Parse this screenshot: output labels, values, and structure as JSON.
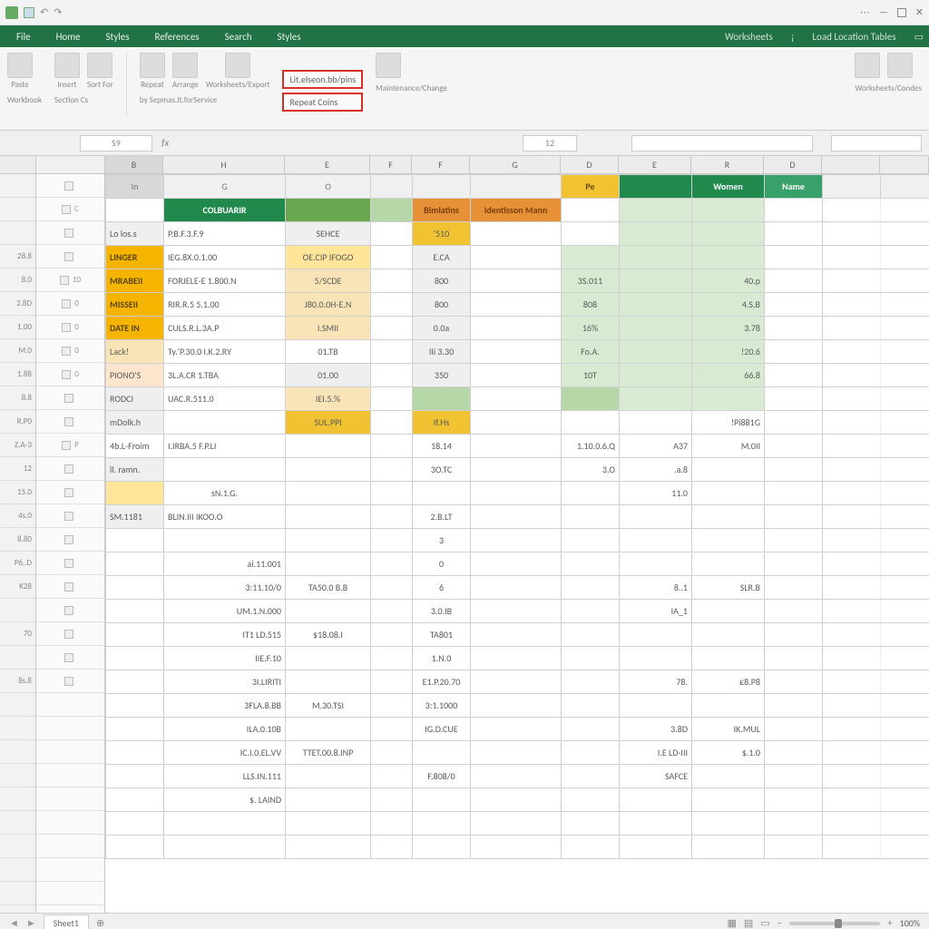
{
  "titlebar": {
    "qat_save": "",
    "account": "",
    "minimize": "—"
  },
  "tabs": {
    "file": "File",
    "home": "Home",
    "insert": "Styles",
    "pagelayout": "References",
    "formulas": "Search",
    "data": "Styles",
    "review": "Worksheets",
    "view": "Load Location Tables",
    "help": ""
  },
  "ribbon": {
    "btn1": "Paste",
    "btn1b": "",
    "grp1_cap": "Workbook",
    "btn2": "Insert",
    "btn3": "Sort For",
    "btn4": "Repeat",
    "btn4_cap": "Section Cs",
    "btn5": "Arrange",
    "btn5_cap": "by Sepmas.It.forService",
    "btn6": "Worksheets/Export",
    "boxed_top": "Lit.elseon.bb/pins",
    "boxed_bottom": "Repeat Coins",
    "btn7": "Maintenance/Change",
    "btn8_cap": "Worksheets/Condes"
  },
  "fx": {
    "name": "S9",
    "font_size": "12"
  },
  "col_top": {
    "B": "B",
    "C": "H",
    "D": "E",
    "E": "F",
    "F": "F",
    "G": "G",
    "H": "D",
    "I": "E",
    "J": "R",
    "K": "D"
  },
  "subhdr": {
    "B": "In",
    "C": "G",
    "D": "O",
    "H": "Pe",
    "J": "Women",
    "K": "Name"
  },
  "left_labels": [
    "",
    "",
    "",
    "28.8",
    "8.0",
    "2.8D",
    "1.00",
    "M.0",
    "1.88",
    "8.8",
    "R.P0",
    "Z.A-3",
    "12",
    "15.0",
    "4s.0",
    "8.80",
    "P6..D",
    "K28",
    "",
    "70",
    "",
    "8s.8",
    ""
  ],
  "mid_labels": [
    "",
    "C",
    "",
    "",
    "10",
    "0",
    "0",
    "0",
    "0",
    "",
    "",
    "P",
    "",
    "",
    "",
    "",
    "",
    "",
    "",
    "",
    "",
    ""
  ],
  "rows": [
    {
      "b": "",
      "b_cls": "",
      "c": "COLBUARIR",
      "c_cls": "hdr-green-dark",
      "d": "",
      "d_cls": "cell-grn-bar",
      "e": "",
      "e_cls": "cell-green-md",
      "f": "Bimlatins",
      "f_cls": "hdr-orange",
      "g": "Identisson Mann",
      "g_cls": "hdr-orange",
      "h": "",
      "i": "",
      "i_cls": "cell-green-lt",
      "j": "",
      "j_cls": "cell-green-lt",
      "k": ""
    },
    {
      "b": "Lo los.s",
      "b_cls": "lab cell-gray",
      "c": "P.B.F.3.F.9",
      "c_cls": "lab",
      "d": "SEHCE",
      "d_cls": "cell-gray",
      "e": "",
      "f": "'510",
      "f_cls": "cell-yellow-dk",
      "g": "",
      "h": "",
      "i": "",
      "i_cls": "cell-green-lt",
      "j": "",
      "j_cls": "cell-green-lt",
      "k": ""
    },
    {
      "b": "LINGER",
      "b_cls": "lab hdr-row2",
      "c": "IEG.8X.0.1.00",
      "c_cls": "lab",
      "d": "OE.CIP IFOGO",
      "d_cls": "cell-yellow",
      "e": "",
      "f": "E.CA",
      "f_cls": "cell-gray",
      "g": "",
      "h": "",
      "h_cls": "cell-green-lt",
      "i": "",
      "i_cls": "cell-green-lt",
      "j": "",
      "j_cls": "cell-green-lt",
      "k": ""
    },
    {
      "b": "MRABEII",
      "b_cls": "lab hdr-row2",
      "c": "FORJELE-E 1.800.N",
      "c_cls": "lab",
      "d": "5/SCDE",
      "d_cls": "cell-tan",
      "e": "",
      "f": "800",
      "f_cls": "cell-gray",
      "g": "",
      "h": "3S.011",
      "h_cls": "cell-green-lt",
      "i": "",
      "i_cls": "cell-green-lt",
      "j": "40.p",
      "j_cls": "num cell-green-lt",
      "k": ""
    },
    {
      "b": "MISSEII",
      "b_cls": "lab hdr-row2",
      "c": "RIR.R.5 5.1.00",
      "c_cls": "lab",
      "d": "J80.0.0H-E.N",
      "d_cls": "cell-tan",
      "e": "",
      "f": "800",
      "f_cls": "cell-gray",
      "g": "",
      "h": "808",
      "h_cls": "cell-green-lt",
      "i": "",
      "i_cls": "cell-green-lt",
      "j": "4.S.B",
      "j_cls": "num cell-green-lt",
      "k": ""
    },
    {
      "b": "DATE IN",
      "b_cls": "lab hdr-row2",
      "c": "CULS.R.L.3A.P",
      "c_cls": "lab",
      "d": "I.SMII",
      "d_cls": "cell-tan",
      "e": "",
      "f": "0.0a",
      "f_cls": "cell-gray",
      "g": "",
      "h": "16%",
      "h_cls": "cell-green-lt",
      "i": "",
      "i_cls": "cell-green-lt",
      "j": "3.78",
      "j_cls": "num cell-green-lt",
      "k": ""
    },
    {
      "b": "Lack!",
      "b_cls": "lab cell-tan",
      "c": "Ty.'P.30.0 I.K.2.RY",
      "c_cls": "lab",
      "d": "01.TB",
      "d_cls": "",
      "e": "",
      "f": "IIi 3.30",
      "f_cls": "cell-gray",
      "g": "",
      "h": "Fo.A.",
      "h_cls": "cell-green-lt",
      "i": "",
      "i_cls": "cell-green-lt",
      "j": "!20.6",
      "j_cls": "num cell-green-lt",
      "k": ""
    },
    {
      "b": "PIONO'S",
      "b_cls": "lab cell-peach",
      "c": "3L.A.CR 1.TBA",
      "c_cls": "lab",
      "d": "01.00",
      "d_cls": "cell-gray",
      "e": "",
      "f": "350",
      "f_cls": "cell-gray",
      "g": "",
      "h": "10T",
      "h_cls": "cell-green-lt",
      "i": "",
      "i_cls": "cell-green-lt",
      "j": "66.8",
      "j_cls": "num cell-green-lt",
      "k": ""
    },
    {
      "b": "RODCI",
      "b_cls": "lab cell-gray",
      "c": "UAC.R.511.0",
      "c_cls": "lab",
      "d": "IEI.5.%",
      "d_cls": "cell-tan",
      "e": "",
      "f": "",
      "f_cls": "cell-green-md",
      "g": "",
      "h": "",
      "h_cls": "cell-green-md",
      "i": "",
      "i_cls": "cell-green-lt",
      "j": "",
      "j_cls": "cell-green-lt",
      "k": ""
    },
    {
      "b": "mDolk.h",
      "b_cls": "lab cell-gray",
      "c": "",
      "d": "SUL.PPI",
      "d_cls": "cell-yellow-dk",
      "e": "",
      "f": "If.Hs",
      "f_cls": "cell-yellow-dk",
      "g": "",
      "h": "",
      "i": "",
      "i_cls": "",
      "j": "!Pi881G",
      "j_cls": "num",
      "k": ""
    },
    {
      "b": "4b.L-Froim",
      "b_cls": "lab",
      "c": "I.IRBA.5 F.P.LI",
      "c_cls": "lab",
      "d": "",
      "e": "",
      "f": "18.14",
      "f_cls": "",
      "g": "",
      "h": "1.10.0.6.Q",
      "h_cls": "num",
      "i": "A37",
      "i_cls": "num",
      "j": "M.0II",
      "j_cls": "num",
      "k": ""
    },
    {
      "b": "ll. ramn.",
      "b_cls": "lab cell-gray",
      "c": "",
      "d": "",
      "e": "",
      "f": "3O.TC",
      "f_cls": "",
      "g": "",
      "h": "3.O",
      "h_cls": "num",
      "i": ".a.8",
      "i_cls": "num",
      "j": "",
      "j_cls": "",
      "k": ""
    },
    {
      "b": "",
      "b_cls": "cell-yellow",
      "c": "sN.1.G.",
      "c_cls": "",
      "d": "",
      "e": "",
      "f": "",
      "f_cls": "",
      "g": "",
      "h": "",
      "i": "11.0",
      "i_cls": "num",
      "j": "",
      "j_cls": "",
      "k": ""
    },
    {
      "b": "SM.1181",
      "b_cls": "lab cell-gray",
      "c": "BLIN.III IKOO.O",
      "c_cls": "lab",
      "d": "",
      "e": "",
      "f": "2.B.LT",
      "f_cls": "",
      "g": "",
      "h": "",
      "i": "",
      "i_cls": "",
      "j": "",
      "j_cls": "",
      "k": ""
    },
    {
      "b": "",
      "c": "",
      "d": "",
      "e": "",
      "f": "3",
      "f_cls": "",
      "g": "",
      "h": "",
      "i": "",
      "i_cls": "",
      "j": "",
      "j_cls": "",
      "k": ""
    },
    {
      "b": "",
      "c": "ai.11.001",
      "c_cls": "num",
      "d": "",
      "e": "",
      "f": "0",
      "f_cls": "",
      "g": "",
      "h": "",
      "i": "",
      "i_cls": "",
      "j": "",
      "j_cls": "",
      "k": ""
    },
    {
      "b": "",
      "c": "3:11.10/0",
      "c_cls": "num",
      "d": "TA50.0 B.B",
      "d_cls": "",
      "e": "",
      "f": "6",
      "f_cls": "",
      "g": "",
      "h": "",
      "i": "8..1",
      "i_cls": "num",
      "j": "SLR.B",
      "j_cls": "num",
      "k": ""
    },
    {
      "b": "",
      "c": "UM.1.N.000",
      "c_cls": "num",
      "d": "",
      "e": "",
      "f": "3.0.IB",
      "f_cls": "",
      "g": "",
      "h": "",
      "i": "IA_1",
      "i_cls": "num",
      "j": "",
      "j_cls": "",
      "k": ""
    },
    {
      "b": "",
      "c": "IT1 LD.515",
      "c_cls": "num",
      "d": "$18.08.I",
      "d_cls": "",
      "e": "",
      "f": "TA801",
      "f_cls": "",
      "g": "",
      "h": "",
      "i": "",
      "i_cls": "",
      "j": "",
      "j_cls": "",
      "k": ""
    },
    {
      "b": "",
      "c": "IIE.F.10",
      "c_cls": "num",
      "d": "",
      "e": "",
      "f": "1.N.0",
      "f_cls": "",
      "g": "",
      "h": "",
      "i": "",
      "i_cls": "",
      "j": "",
      "j_cls": "",
      "k": ""
    },
    {
      "b": "",
      "c": "3I.LIRITI",
      "c_cls": "num",
      "d": "",
      "e": "",
      "f": "E1.P.20.70",
      "f_cls": "",
      "g": "",
      "h": "",
      "i": "78.",
      "i_cls": "num",
      "j": "£8.P8",
      "j_cls": "num",
      "k": ""
    },
    {
      "b": "",
      "c": "3FLA.8.BB",
      "c_cls": "num",
      "d": "M.30.TSI",
      "d_cls": "",
      "e": "",
      "f": "3:1.1000",
      "f_cls": "",
      "g": "",
      "h": "",
      "i": "",
      "i_cls": "",
      "j": "",
      "j_cls": "",
      "k": ""
    },
    {
      "b": "",
      "c": "ILA.0.10B",
      "c_cls": "num",
      "d": "",
      "e": "",
      "f": "IG.D.CUE",
      "f_cls": "",
      "g": "",
      "h": "",
      "i": "3.8D",
      "i_cls": "num",
      "j": "IK.MUL",
      "j_cls": "num",
      "k": ""
    },
    {
      "b": "",
      "c": "IC.I.0.EL.VV",
      "c_cls": "num",
      "d": "TTET.00.8.INP",
      "d_cls": "",
      "e": "",
      "f": "",
      "f_cls": "",
      "g": "",
      "h": "",
      "i": "I.E LD-III",
      "i_cls": "num",
      "j": "$.1.0",
      "j_cls": "num",
      "k": ""
    },
    {
      "b": "",
      "c": "LLS.IN.111",
      "c_cls": "num",
      "d": "",
      "e": "",
      "f": "F.808/0",
      "f_cls": "",
      "g": "",
      "h": "",
      "i": "SAFCE",
      "i_cls": "num",
      "j": "",
      "j_cls": "",
      "k": ""
    },
    {
      "b": "",
      "c": "$. LAIND",
      "c_cls": "num",
      "d": "",
      "e": "",
      "f": "",
      "f_cls": "",
      "g": "",
      "h": "",
      "i": "",
      "i_cls": "",
      "j": "",
      "j_cls": "",
      "k": ""
    },
    {
      "b": "",
      "c": "",
      "d": "",
      "e": "",
      "f": "",
      "f_cls": "",
      "g": "",
      "h": "",
      "i": "",
      "i_cls": "",
      "j": "",
      "j_cls": "",
      "k": ""
    },
    {
      "b": "",
      "c": "",
      "d": "",
      "e": "",
      "f": "",
      "f_cls": "",
      "g": "",
      "h": "",
      "i": "",
      "i_cls": "",
      "j": "",
      "j_cls": "",
      "k": ""
    }
  ],
  "status": {
    "sheet1": "Sheet1",
    "zoom": "100%"
  }
}
